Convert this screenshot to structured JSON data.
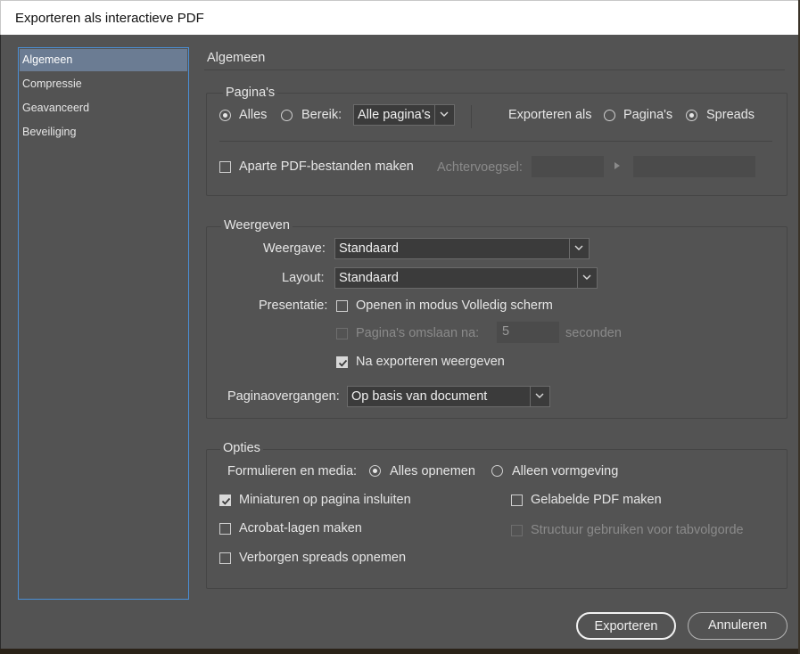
{
  "window": {
    "title": "Exporteren als interactieve PDF"
  },
  "nav": {
    "items": [
      {
        "label": "Algemeen",
        "selected": true
      },
      {
        "label": "Compressie",
        "selected": false
      },
      {
        "label": "Geavanceerd",
        "selected": false
      },
      {
        "label": "Beveiliging",
        "selected": false
      }
    ]
  },
  "main": {
    "title": "Algemeen"
  },
  "pages": {
    "legend": "Pagina's",
    "all_label": "Alles",
    "range_label": "Bereik:",
    "range_value": "Alle pagina's",
    "export_as_label": "Exporteren als",
    "pages_option": "Pagina's",
    "spreads_option": "Spreads",
    "selected_range": "all",
    "selected_export_as": "spreads",
    "separate_pdf_label": "Aparte PDF-bestanden maken",
    "separate_pdf_checked": false,
    "suffix_label": "Achtervoegsel:"
  },
  "view": {
    "legend": "Weergeven",
    "view_label": "Weergave:",
    "view_value": "Standaard",
    "layout_label": "Layout:",
    "layout_value": "Standaard",
    "presentation_label": "Presentatie:",
    "fullscreen_label": "Openen in modus Volledig scherm",
    "fullscreen_checked": false,
    "flip_label": "Pagina's omslaan na:",
    "flip_value": "5",
    "flip_unit": "seconden",
    "flip_checked": false,
    "view_after_label": "Na exporteren weergeven",
    "view_after_checked": true,
    "transitions_label": "Paginaovergangen:",
    "transitions_value": "Op basis van document"
  },
  "options": {
    "legend": "Opties",
    "forms_label": "Formulieren en media:",
    "include_all": "Alles opnemen",
    "appearance_only": "Alleen vormgeving",
    "selected_forms": "include_all",
    "thumbnails_label": "Miniaturen op pagina insluiten",
    "thumbnails_checked": true,
    "tagged_label": "Gelabelde PDF maken",
    "tagged_checked": false,
    "layers_label": "Acrobat-lagen maken",
    "layers_checked": false,
    "structure_label": "Structuur gebruiken voor tabvolgorde",
    "structure_checked": false,
    "hidden_spreads_label": "Verborgen spreads opnemen",
    "hidden_spreads_checked": false
  },
  "buttons": {
    "export": "Exporteren",
    "cancel": "Annuleren"
  },
  "icons": {
    "dropdown": "chevron-down-icon",
    "checkmark": "checkmark-icon",
    "arrow": "arrow-right-icon"
  },
  "colors": {
    "dialog_bg": "#535353",
    "nav_selected": "#6b7c93",
    "nav_border": "#4a8fd6"
  }
}
